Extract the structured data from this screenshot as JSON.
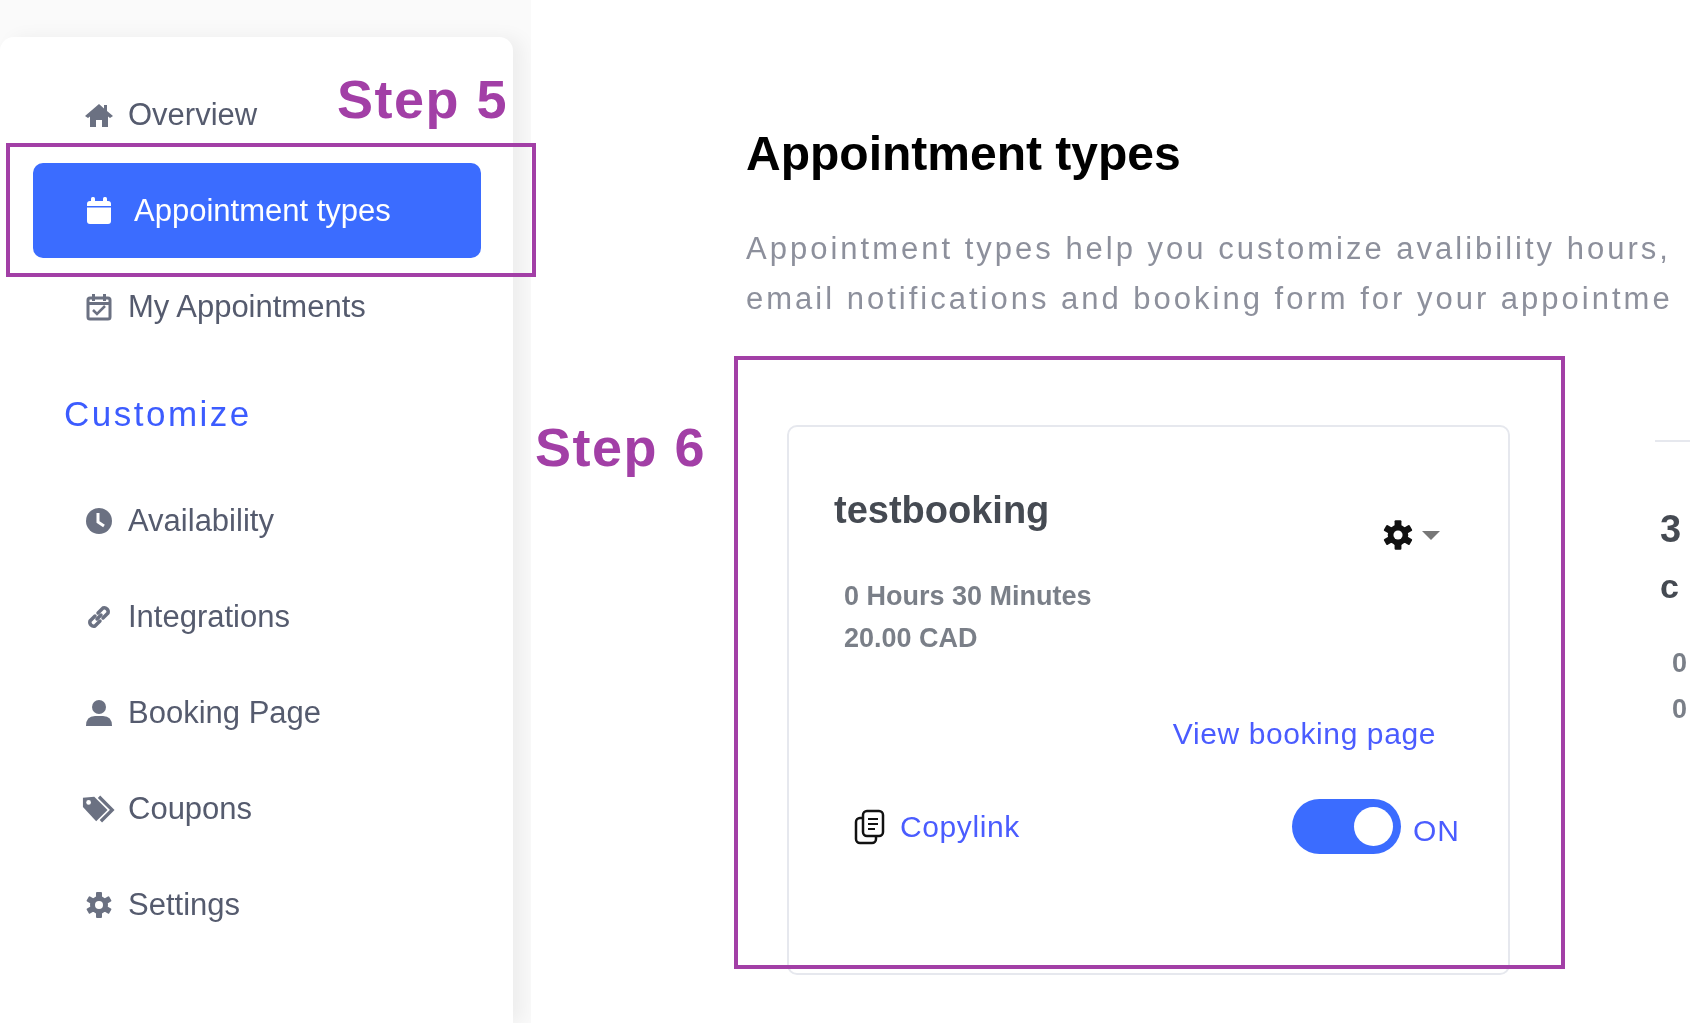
{
  "sidebar": {
    "items": [
      {
        "label": "Overview",
        "selected": false
      },
      {
        "label": "Appointment types",
        "selected": true
      },
      {
        "label": "My Appointments",
        "selected": false
      }
    ],
    "section_title": "Customize",
    "customize_items": [
      {
        "label": "Availability",
        "selected": false
      },
      {
        "label": "Integrations",
        "selected": false
      },
      {
        "label": "Booking Page",
        "selected": false
      },
      {
        "label": "Coupons",
        "selected": false
      },
      {
        "label": "Settings",
        "selected": false
      }
    ]
  },
  "main": {
    "title": "Appointment types",
    "description_lines": [
      "Appointment types help you customize avalibility hours,",
      "email notifications and booking form for your appointme"
    ],
    "card": {
      "name": "testbooking",
      "duration": "0 Hours 30 Minutes",
      "price": "20.00 CAD",
      "link": "View booking page",
      "copy": "Copylink",
      "enabled": true,
      "toggle_label": "ON"
    },
    "partial_card": {
      "line_1": "3",
      "line_2": "c",
      "line_3": "0",
      "line_4": "0"
    }
  },
  "annotations": [
    {
      "text": "Step 5"
    },
    {
      "text": "Step 6"
    }
  ]
}
